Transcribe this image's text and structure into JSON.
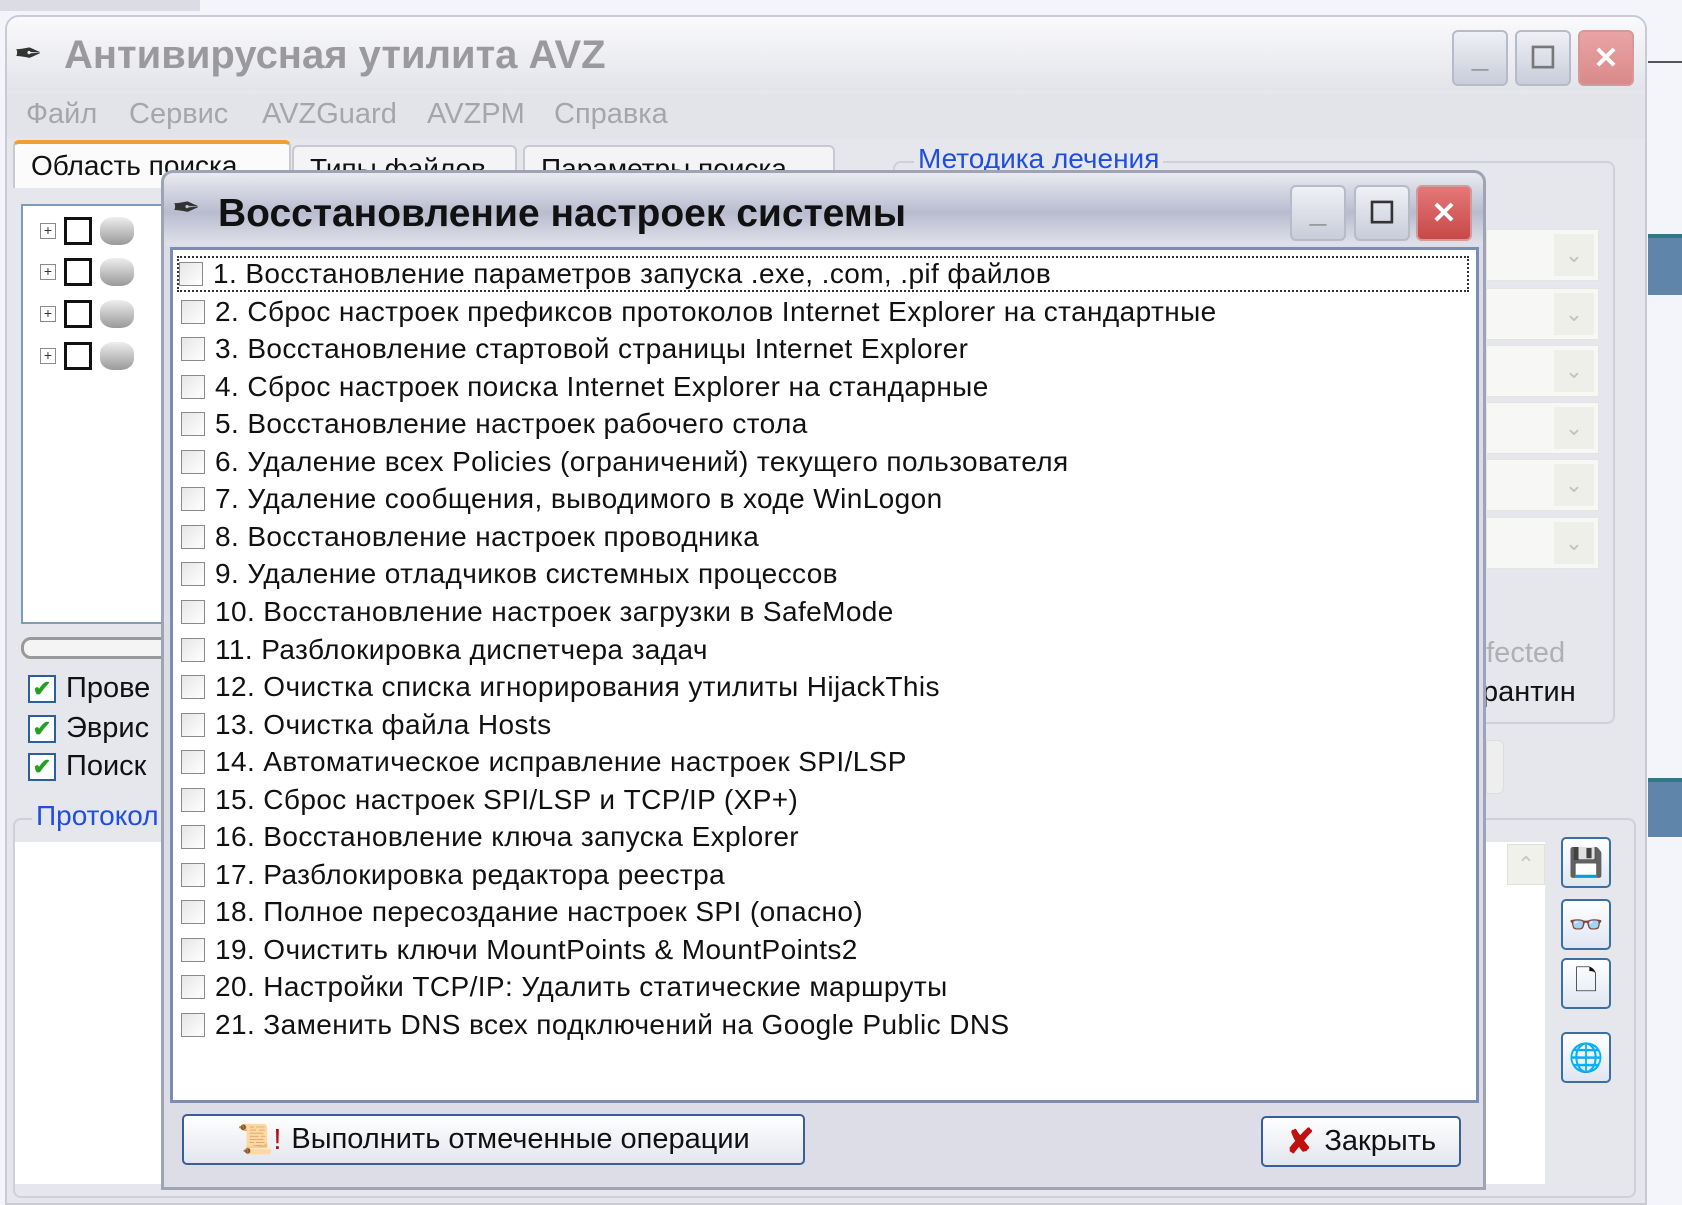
{
  "main_window": {
    "title": "Антивирусная утилита AVZ",
    "menu": [
      "Файл",
      "Сервис",
      "AVZGuard",
      "AVZPM",
      "Справка"
    ],
    "tabs": [
      "Область поиска",
      "Типы файлов",
      "Параметры поиска"
    ],
    "treatment_group_label": "Методика лечения",
    "left_checkboxes": [
      {
        "label": "Прове",
        "checked": true
      },
      {
        "label": "Эврис",
        "checked": true
      },
      {
        "label": "Поиск",
        "checked": true
      }
    ],
    "infected_text": "nfected",
    "quarantine_text": "рантин",
    "log_group_label": "Протокол"
  },
  "dialog": {
    "title": "Восстановление настроек системы",
    "items": [
      "1. Восстановление параметров запуска .exe, .com, .pif файлов",
      "2. Сброс настроек префиксов протоколов Internet Explorer на стандартные",
      "3. Восстановление стартовой страницы Internet Explorer",
      "4. Сброс настроек поиска Internet Explorer на стандарные",
      "5. Восстановление настроек рабочего стола",
      "6. Удаление всех Policies (ограничений) текущего пользователя",
      "7. Удаление сообщения, выводимого в ходе WinLogon",
      "8. Восстановление настроек проводника",
      "9. Удаление отладчиков системных процессов",
      "10. Восстановление настроек загрузки в SafeMode",
      "11. Разблокировка диспетчера задач",
      "12. Очистка списка игнорирования утилиты HijackThis",
      "13. Очистка файла Hosts",
      "14. Автоматическое исправление настроек SPI/LSP",
      "15. Сброс настроек SPI/LSP и TCP/IP (XP+)",
      "16. Восстановление ключа запуска Explorer",
      "17. Разблокировка редактора реестра",
      "18. Полное пересоздание настроек SPI (опасно)",
      "19. Очистить ключи MountPoints & MountPoints2",
      "20. Настройки TCP/IP: Удалить статические маршруты",
      "21. Заменить DNS всех подключений на Google Public DNS"
    ],
    "execute_button": "Выполнить отмеченные операции",
    "close_button": "Закрыть"
  }
}
